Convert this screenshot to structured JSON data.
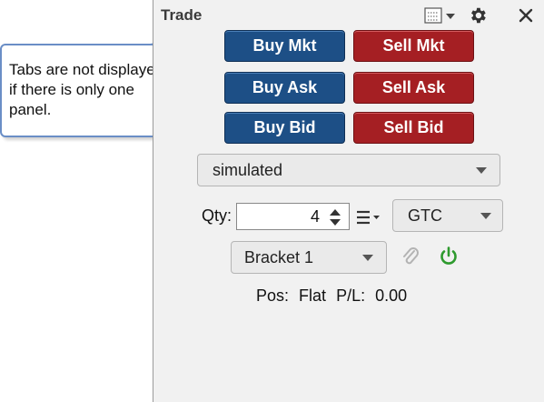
{
  "panel": {
    "title": "Trade",
    "icons": [
      "layout-menu-icon",
      "gear-icon",
      "close-icon"
    ]
  },
  "buttons": {
    "buy_mkt": "Buy Mkt",
    "sell_mkt": "Sell Mkt",
    "buy_ask": "Buy Ask",
    "sell_ask": "Sell Ask",
    "buy_bid": "Buy Bid",
    "sell_bid": "Sell Bid"
  },
  "account": {
    "selected": "simulated"
  },
  "quantity": {
    "label": "Qty:",
    "value": "4"
  },
  "tif": {
    "selected": "GTC"
  },
  "bracket": {
    "selected": "Bracket 1"
  },
  "position": {
    "pos_label": "Pos:",
    "pos_value": "Flat",
    "pl_label": "P/L:",
    "pl_value": "0.00"
  },
  "callout": {
    "text": "Tabs are not displayed if there is only one panel."
  },
  "colors": {
    "buy": "#1d4f86",
    "sell": "#a51f23",
    "power": "#2e9a2e"
  }
}
